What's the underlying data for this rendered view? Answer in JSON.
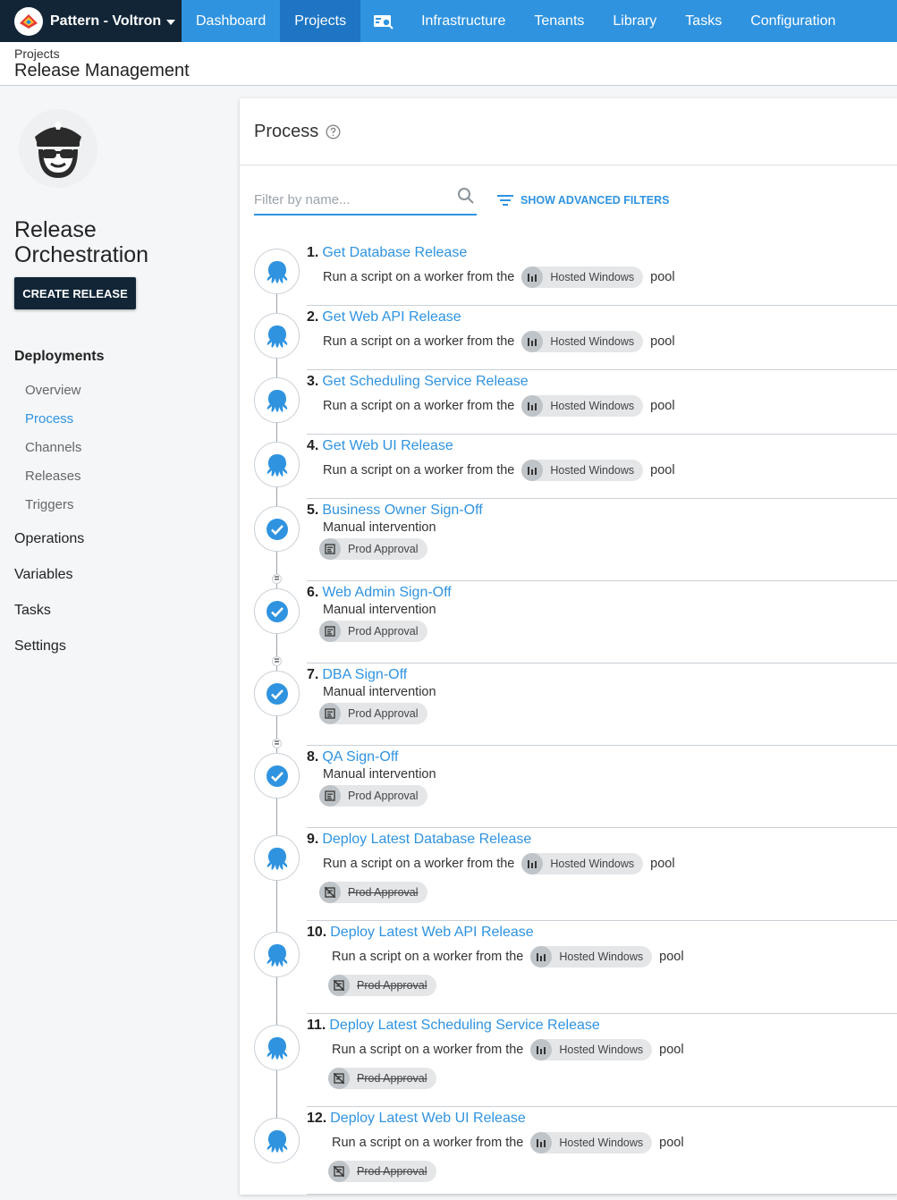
{
  "nav": {
    "space_name": "Pattern - Voltron",
    "items": [
      {
        "label": "Dashboard",
        "active": false
      },
      {
        "label": "Projects",
        "active": true
      },
      {
        "label": "Infrastructure",
        "active": false
      },
      {
        "label": "Tenants",
        "active": false
      },
      {
        "label": "Library",
        "active": false
      },
      {
        "label": "Tasks",
        "active": false
      },
      {
        "label": "Configuration",
        "active": false
      }
    ],
    "search_icon": "search-results-icon"
  },
  "header": {
    "breadcrumb": "Projects",
    "title": "Release Management"
  },
  "sidebar": {
    "project_name": "Release Orchestration",
    "create_release": "CREATE RELEASE",
    "deployments": "Deployments",
    "deployments_items": [
      "Overview",
      "Process",
      "Channels",
      "Releases",
      "Triggers"
    ],
    "active_item": "Process",
    "sections": [
      "Operations",
      "Variables",
      "Tasks",
      "Settings"
    ]
  },
  "process": {
    "title": "Process",
    "filter_placeholder": "Filter by name...",
    "advanced_filters": "SHOW ADVANCED FILTERS",
    "steps": [
      {
        "num": "1.",
        "name": "Get Database Release",
        "type": "script",
        "desc_pre": "Run a script on a worker from the",
        "pool": "Hosted Windows",
        "desc_post": "pool"
      },
      {
        "num": "2.",
        "name": "Get Web API Release",
        "type": "script",
        "desc_pre": "Run a script on a worker from the",
        "pool": "Hosted Windows",
        "desc_post": "pool"
      },
      {
        "num": "3.",
        "name": "Get Scheduling Service Release",
        "type": "script",
        "desc_pre": "Run a script on a worker from the",
        "pool": "Hosted Windows",
        "desc_post": "pool"
      },
      {
        "num": "4.",
        "name": "Get Web UI Release",
        "type": "script",
        "desc_pre": "Run a script on a worker from the",
        "pool": "Hosted Windows",
        "desc_post": "pool"
      },
      {
        "num": "5.",
        "name": "Business Owner Sign-Off",
        "type": "manual",
        "desc_pre": "Manual intervention",
        "env": "Prod Approval"
      },
      {
        "num": "6.",
        "name": "Web Admin Sign-Off",
        "type": "manual",
        "desc_pre": "Manual intervention",
        "env": "Prod Approval"
      },
      {
        "num": "7.",
        "name": "DBA Sign-Off",
        "type": "manual",
        "desc_pre": "Manual intervention",
        "env": "Prod Approval"
      },
      {
        "num": "8.",
        "name": "QA Sign-Off",
        "type": "manual",
        "desc_pre": "Manual intervention",
        "env": "Prod Approval"
      },
      {
        "num": "9.",
        "name": "Deploy Latest Database Release",
        "type": "script-excluded",
        "desc_pre": "Run a script on a worker from the",
        "pool": "Hosted Windows",
        "desc_post": "pool",
        "env": "Prod Approval"
      },
      {
        "num": "10.",
        "name": "Deploy Latest Web API Release",
        "type": "script-excluded",
        "desc_pre": "Run a script on a worker from the",
        "pool": "Hosted Windows",
        "desc_post": "pool",
        "env": "Prod Approval"
      },
      {
        "num": "11.",
        "name": "Deploy Latest Scheduling Service Release",
        "type": "script-excluded",
        "desc_pre": "Run a script on a worker from the",
        "pool": "Hosted Windows",
        "desc_post": "pool",
        "env": "Prod Approval"
      },
      {
        "num": "12.",
        "name": "Deploy Latest Web UI Release",
        "type": "script-excluded",
        "desc_pre": "Run a script on a worker from the",
        "pool": "Hosted Windows",
        "desc_post": "pool",
        "env": "Prod Approval"
      }
    ]
  },
  "colors": {
    "brand_blue": "#2f93e0",
    "nav_dark": "#112536",
    "nav_active": "#1d75c4"
  }
}
